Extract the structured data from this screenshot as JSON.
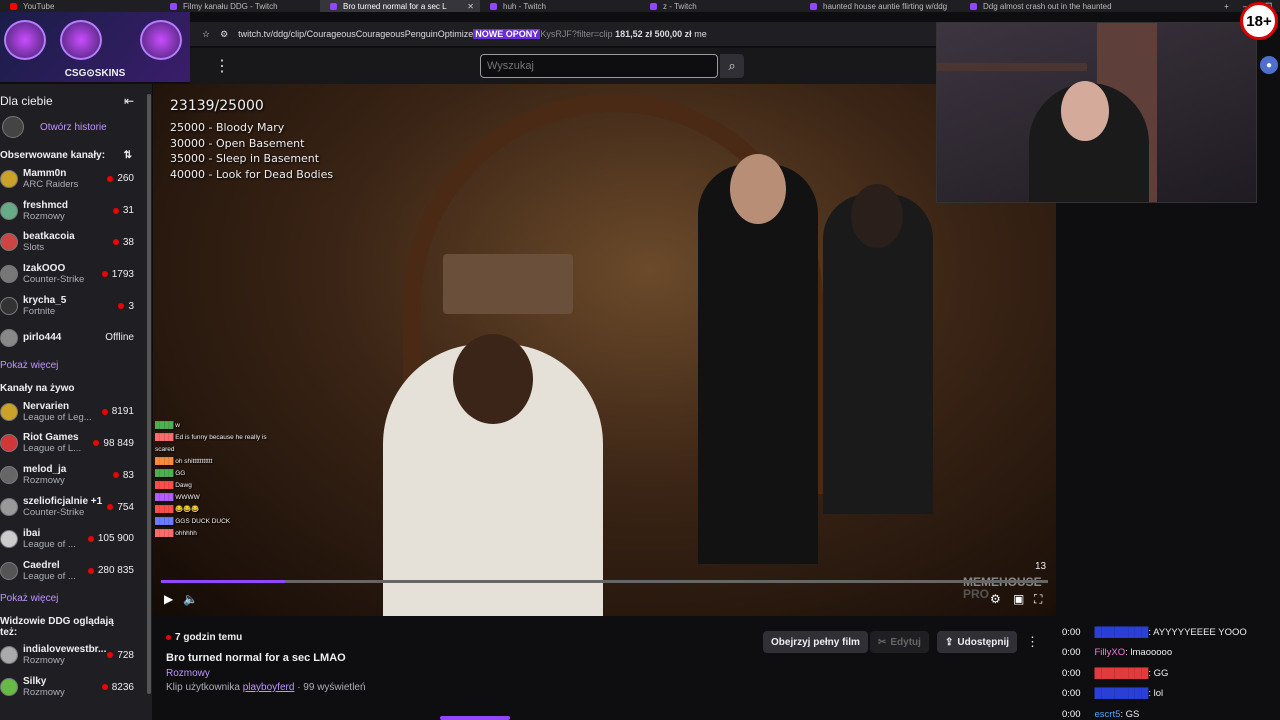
{
  "browser": {
    "tabs": [
      {
        "label": "YouTube",
        "active": false
      },
      {
        "label": "Filmy kanału DDG - Twitch",
        "active": false
      },
      {
        "label": "Bro turned normal for a sec L",
        "active": true
      },
      {
        "label": "huh - Twitch",
        "active": false
      },
      {
        "label": "z - Twitch",
        "active": false
      },
      {
        "label": "haunted house auntie flirting w/ddg",
        "active": false
      },
      {
        "label": "Ddg almost crash out in the haunted",
        "active": false
      }
    ],
    "new_tab": "+",
    "url": "twitch.tv/ddg/clip/CourageousCourageousPenguinOptimize",
    "url_overlay_label": "NOWE OPONY",
    "url_tail": "KysRJF?filter=clip",
    "url_price1": "181,52 zł",
    "url_price2": "500,00 zł",
    "url_end": "me"
  },
  "promo": {
    "brand": "CSG⊙SKINS"
  },
  "topbar": {
    "search_placeholder": "Wyszukaj"
  },
  "sidebar": {
    "title": "Dla ciebie",
    "history_label": "Otwórz historie",
    "followed_title": "Obserwowane kanały:",
    "followed": [
      {
        "name": "Mamm0n",
        "game": "ARC Raiders",
        "count": "260"
      },
      {
        "name": "freshmcd",
        "game": "Rozmowy",
        "count": "31"
      },
      {
        "name": "beatkacoia",
        "game": "Slots",
        "count": "38"
      },
      {
        "name": "IzakOOO",
        "game": "Counter-Strike",
        "count": "1793"
      },
      {
        "name": "krycha_5",
        "game": "Fortnite",
        "count": "3"
      },
      {
        "name": "pirlo444",
        "game": "",
        "count": "Offline"
      }
    ],
    "more1": "Pokaż więcej",
    "live_title": "Kanały na żywo",
    "live": [
      {
        "name": "Nervarien",
        "game": "League of Leg...",
        "count": "8191"
      },
      {
        "name": "Riot Games",
        "game": "League of L...",
        "count": "98 849"
      },
      {
        "name": "melod_ja",
        "game": "Rozmowy",
        "count": "83"
      },
      {
        "name": "szelioficjalnie +1",
        "game": "Counter-Strike",
        "count": "754"
      },
      {
        "name": "ibai",
        "game": "League of ...",
        "count": "105 900"
      },
      {
        "name": "Caedrel",
        "game": "League of ...",
        "count": "280 835"
      }
    ],
    "more2": "Pokaż więcej",
    "viewers_title": "Widzowie DDG oglądają też:",
    "viewers": [
      {
        "name": "indialovewestbr...",
        "game": "Rozmowy",
        "count": "728"
      },
      {
        "name": "Silky",
        "game": "Rozmowy",
        "count": "8236"
      }
    ]
  },
  "player": {
    "goal_progress": "23139/25000",
    "goals": [
      "25000 - Bloody Mary",
      "30000 - Open Basement",
      "35000 - Sleep in Basement",
      "40000 - Look for Dead Bodies"
    ],
    "overlay_chat": [
      {
        "user": "",
        "msg": "w"
      },
      {
        "user": "",
        "msg": "Ed is funny because he really is scared"
      },
      {
        "user": "",
        "msg": "oh shittttttttttt"
      },
      {
        "user": "",
        "msg": "GG"
      },
      {
        "user": "",
        "msg": "Dawg"
      },
      {
        "user": "",
        "msg": "WWWW"
      },
      {
        "user": "",
        "msg": "😂😂😂"
      },
      {
        "user": "",
        "msg": "GGS DUCK DUCK"
      },
      {
        "user": "",
        "msg": "ohhhhh"
      }
    ],
    "watermark_1": "MEMEHOUSE",
    "watermark_2": "PRO",
    "count_label": "13",
    "progress": 0.14
  },
  "clip": {
    "time_ago": "7 godzin temu",
    "title": "Bro turned normal for a sec LMAO",
    "category": "Rozmowy",
    "byline_prefix": "Klip użytkownika",
    "author": "playboyferd",
    "views": "· 99 wyświetleń",
    "btn_full": "Obejrzyj pełny film",
    "btn_edit": "Edytuj",
    "btn_share": "Udostępnij"
  },
  "chat": [
    {
      "time": "0:00",
      "user": "",
      "msg": ": AYYYYYEEEE YOOO"
    },
    {
      "time": "0:00",
      "user": "FillyXO",
      "msg": ": lmaooooo"
    },
    {
      "time": "0:00",
      "user": "",
      "msg": ": GG"
    },
    {
      "time": "0:00",
      "user": "",
      "msg": ": lol"
    },
    {
      "time": "0:00",
      "user": "escrt5",
      "msg": ": GS"
    }
  ],
  "age_badge": "18+",
  "colors": {
    "accent": "#9147ff",
    "live": "#eb0400",
    "link": "#bf94ff"
  }
}
